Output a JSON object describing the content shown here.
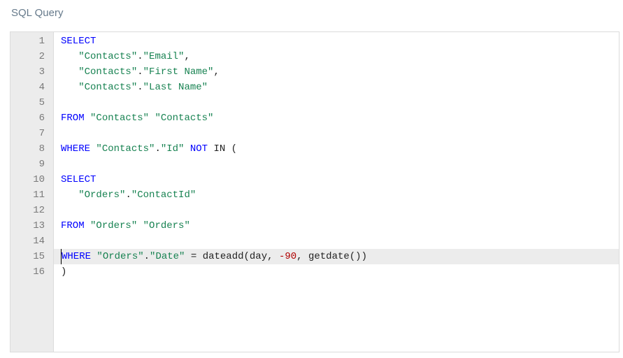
{
  "panel": {
    "title": "SQL Query"
  },
  "editor": {
    "active_line_index": 14,
    "cursor_col": 0,
    "lines": [
      {
        "n": 1,
        "tokens": [
          {
            "t": "SELECT",
            "c": "kw"
          }
        ]
      },
      {
        "n": 2,
        "tokens": [
          {
            "t": "   ",
            "c": "punc"
          },
          {
            "t": "\"Contacts\"",
            "c": "str"
          },
          {
            "t": ".",
            "c": "punc"
          },
          {
            "t": "\"Email\"",
            "c": "str"
          },
          {
            "t": ",",
            "c": "punc"
          }
        ]
      },
      {
        "n": 3,
        "tokens": [
          {
            "t": "   ",
            "c": "punc"
          },
          {
            "t": "\"Contacts\"",
            "c": "str"
          },
          {
            "t": ".",
            "c": "punc"
          },
          {
            "t": "\"First Name\"",
            "c": "str"
          },
          {
            "t": ",",
            "c": "punc"
          }
        ]
      },
      {
        "n": 4,
        "tokens": [
          {
            "t": "   ",
            "c": "punc"
          },
          {
            "t": "\"Contacts\"",
            "c": "str"
          },
          {
            "t": ".",
            "c": "punc"
          },
          {
            "t": "\"Last Name\"",
            "c": "str"
          }
        ]
      },
      {
        "n": 5,
        "tokens": []
      },
      {
        "n": 6,
        "tokens": [
          {
            "t": "FROM",
            "c": "kw"
          },
          {
            "t": " ",
            "c": "punc"
          },
          {
            "t": "\"Contacts\"",
            "c": "str"
          },
          {
            "t": " ",
            "c": "punc"
          },
          {
            "t": "\"Contacts\"",
            "c": "str"
          }
        ]
      },
      {
        "n": 7,
        "tokens": []
      },
      {
        "n": 8,
        "tokens": [
          {
            "t": "WHERE",
            "c": "kw"
          },
          {
            "t": " ",
            "c": "punc"
          },
          {
            "t": "\"Contacts\"",
            "c": "str"
          },
          {
            "t": ".",
            "c": "punc"
          },
          {
            "t": "\"Id\"",
            "c": "str"
          },
          {
            "t": " ",
            "c": "punc"
          },
          {
            "t": "NOT",
            "c": "kw"
          },
          {
            "t": " IN (",
            "c": "punc"
          }
        ]
      },
      {
        "n": 9,
        "tokens": []
      },
      {
        "n": 10,
        "tokens": [
          {
            "t": "SELECT",
            "c": "kw"
          }
        ]
      },
      {
        "n": 11,
        "tokens": [
          {
            "t": "   ",
            "c": "punc"
          },
          {
            "t": "\"Orders\"",
            "c": "str"
          },
          {
            "t": ".",
            "c": "punc"
          },
          {
            "t": "\"ContactId\"",
            "c": "str"
          }
        ]
      },
      {
        "n": 12,
        "tokens": []
      },
      {
        "n": 13,
        "tokens": [
          {
            "t": "FROM",
            "c": "kw"
          },
          {
            "t": " ",
            "c": "punc"
          },
          {
            "t": "\"Orders\"",
            "c": "str"
          },
          {
            "t": " ",
            "c": "punc"
          },
          {
            "t": "\"Orders\"",
            "c": "str"
          }
        ]
      },
      {
        "n": 14,
        "tokens": []
      },
      {
        "n": 15,
        "tokens": [
          {
            "t": "WHERE",
            "c": "kw"
          },
          {
            "t": " ",
            "c": "punc"
          },
          {
            "t": "\"Orders\"",
            "c": "str"
          },
          {
            "t": ".",
            "c": "punc"
          },
          {
            "t": "\"Date\"",
            "c": "str"
          },
          {
            "t": " = ",
            "c": "punc"
          },
          {
            "t": "dateadd",
            "c": "fn"
          },
          {
            "t": "(",
            "c": "punc"
          },
          {
            "t": "day",
            "c": "fn"
          },
          {
            "t": ", ",
            "c": "punc"
          },
          {
            "t": "-90",
            "c": "num"
          },
          {
            "t": ", ",
            "c": "punc"
          },
          {
            "t": "getdate",
            "c": "fn"
          },
          {
            "t": "())",
            "c": "punc"
          }
        ]
      },
      {
        "n": 16,
        "tokens": [
          {
            "t": ")",
            "c": "punc"
          }
        ]
      }
    ]
  }
}
